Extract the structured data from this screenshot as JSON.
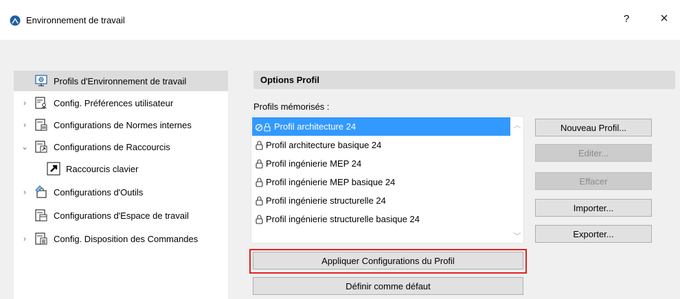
{
  "window": {
    "title": "Environnement de travail",
    "help": "?",
    "close": "×"
  },
  "tree": {
    "items": [
      {
        "label": "Profils d'Environnement de travail",
        "expander": "",
        "icon": "monitor-profile-icon",
        "selected": true
      },
      {
        "label": "Config. Préférences utilisateur",
        "expander": "›",
        "icon": "user-preferences-icon"
      },
      {
        "label": "Configurations de Normes  internes",
        "expander": "›",
        "icon": "standards-icon"
      },
      {
        "label": "Configurations de Raccourcis",
        "expander": "⌄",
        "icon": "shortcuts-config-icon"
      },
      {
        "label": "Raccourcis clavier",
        "expander": "",
        "icon": "keyboard-shortcut-icon",
        "child": true
      },
      {
        "label": "Configurations d'Outils",
        "expander": "›",
        "icon": "tools-icon"
      },
      {
        "label": "Configurations d'Espace de travail",
        "expander": "",
        "icon": "workspace-icon"
      },
      {
        "label": "Config. Disposition des Commandes",
        "expander": "›",
        "icon": "command-layout-icon"
      }
    ]
  },
  "options": {
    "header": "Options Profil",
    "memorized_label": "Profils mémorisés :",
    "profiles": [
      "Profil architecture 24",
      "Profil architecture basique 24",
      "Profil ingénierie MEP 24",
      "Profil ingénierie MEP basique 24",
      "Profil ingénierie structurelle 24",
      "Profil ingénierie structurelle basique 24"
    ],
    "selected_index": 0
  },
  "buttons": {
    "new_profile": "Nouveau Profil...",
    "edit": "Editer...",
    "delete": "Effacer",
    "import": "Importer...",
    "export": "Exporter...",
    "apply": "Appliquer Configurations du Profil",
    "set_default": "Définir comme défaut"
  },
  "colors": {
    "selection": "#3399ff",
    "highlight_border": "#e0201e",
    "brand": "#1d5fa6"
  }
}
